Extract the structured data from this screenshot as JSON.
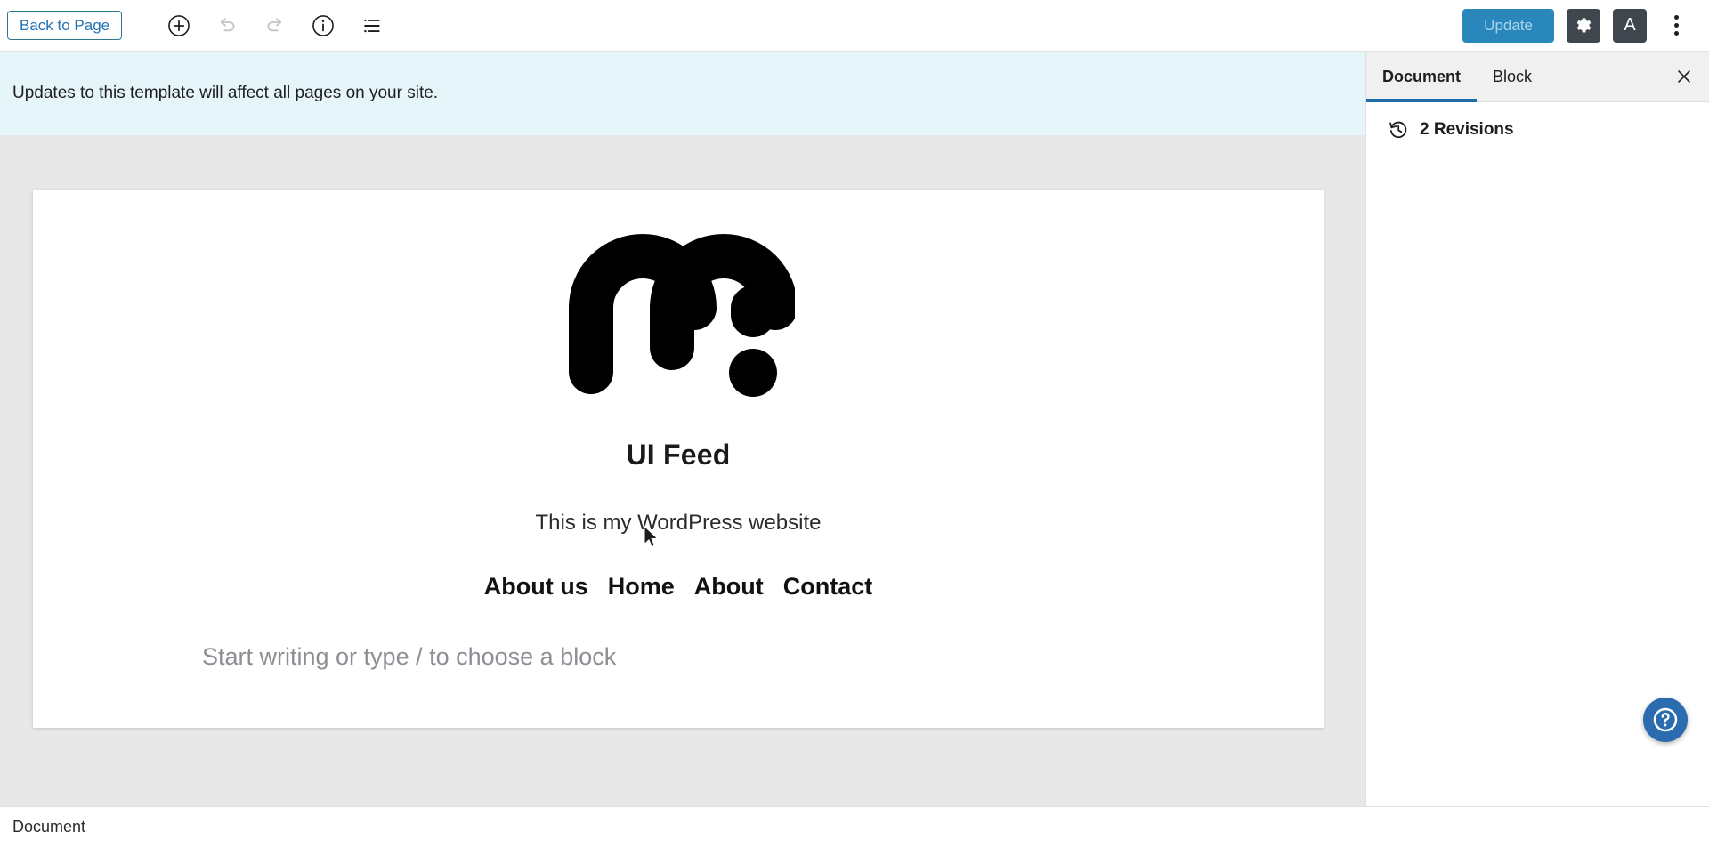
{
  "toolbar": {
    "back_to_page_label": "Back to Page",
    "add_block_title": "Add block",
    "undo_title": "Undo",
    "redo_title": "Redo",
    "details_title": "Details",
    "list_view_title": "List View",
    "update_label": "Update",
    "settings_title": "Settings",
    "styles_letter": "A",
    "styles_title": "Styles",
    "options_title": "Options"
  },
  "notice": {
    "message": "Updates to this template will affect all pages on your site."
  },
  "canvas": {
    "site_title": "UI Feed",
    "site_tagline": "This is my WordPress website",
    "nav_items": [
      {
        "label": "About us"
      },
      {
        "label": "Home"
      },
      {
        "label": "About"
      },
      {
        "label": "Contact"
      }
    ],
    "block_placeholder": "Start writing or type / to choose a block",
    "logo_alt": "site-logo-m"
  },
  "sidebar": {
    "tabs": [
      {
        "label": "Document",
        "active": true
      },
      {
        "label": "Block",
        "active": false
      }
    ],
    "close_label": "✕",
    "panels": [
      {
        "label": "2 Revisions",
        "icon": "revisions-icon"
      }
    ]
  },
  "statusbar": {
    "label": "Document"
  },
  "help": {
    "label": "?"
  },
  "colors": {
    "accent_blue": "#2a87bb",
    "tab_underline": "#1c6ea4",
    "notice_bg": "#e5f5fa",
    "canvas_bg": "#e8e8e8",
    "dark_button": "#40464d",
    "help_blue": "#2b6cb0",
    "link_teal": "#2271b1"
  }
}
